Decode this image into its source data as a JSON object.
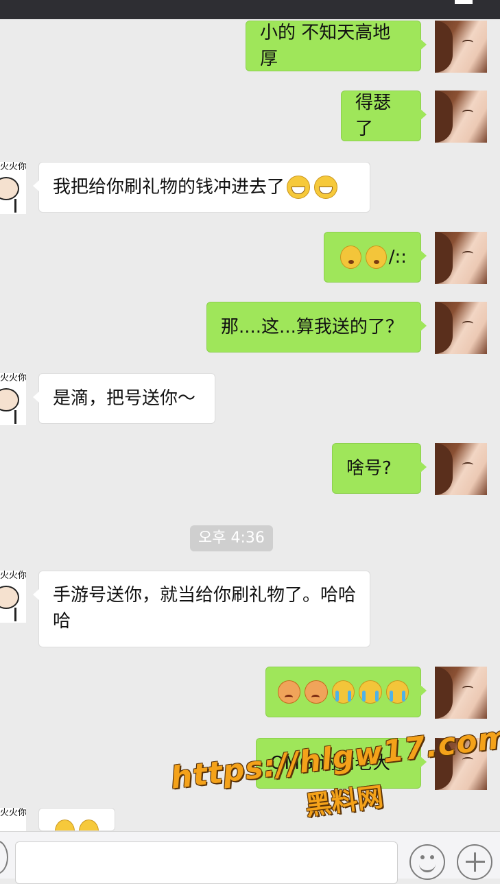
{
  "contact": {
    "avatar_label": "火火你"
  },
  "messages": [
    {
      "side": "out",
      "text": "小的 不知天高地厚"
    },
    {
      "side": "out",
      "text": "得瑟了"
    },
    {
      "side": "in",
      "text": "我把给你刷礼物的钱冲进去了",
      "emojis": [
        "grin-emoji",
        "grin-emoji"
      ]
    },
    {
      "side": "out",
      "text": "/::",
      "emojis": [
        "dizzy-emoji",
        "dizzy-emoji"
      ]
    },
    {
      "side": "out",
      "text": "那....这...算我送的了？"
    },
    {
      "side": "in",
      "text": "是滴，把号送你～"
    },
    {
      "side": "out",
      "text": "啥号?"
    },
    {
      "side": "in",
      "text": "手游号送你，就当给你刷礼物了。哈哈哈"
    },
    {
      "side": "out",
      "emojis": [
        "angry-emoji",
        "angry-emoji",
        "crying-emoji",
        "crying-emoji",
        "crying-emoji"
      ]
    },
    {
      "side": "out",
      "text": "OMG 谢谢老大"
    },
    {
      "side": "in",
      "emojis": [
        "grin-emoji",
        "grin-emoji"
      ]
    }
  ],
  "timestamp": "오후 4:36",
  "watermark": {
    "url": "https://hlgw17.com",
    "name": "黑料网"
  },
  "input_bar": {
    "placeholder": "",
    "icons": [
      "voice-icon",
      "emoji-icon",
      "plus-icon"
    ]
  }
}
